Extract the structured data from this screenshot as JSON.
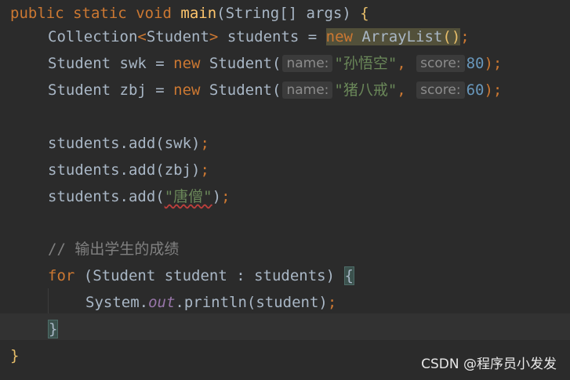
{
  "code": {
    "l1": {
      "kw1": "public",
      "kw2": "static",
      "kw3": "void",
      "fn": "main",
      "params": "(String[] args) ",
      "brace": "{"
    },
    "l2": {
      "type": "Collection",
      "lt": "<",
      "gen": "Student",
      "gt": ">",
      "rest": " students = ",
      "kw": "new",
      "cls": " ArrayList",
      "parens": "()",
      "semi": ";"
    },
    "l3": {
      "decl": "Student swk = ",
      "kw": "new",
      "ctor": " Student(",
      "hint1": "name:",
      "str": "\"孙悟空\"",
      "comma": ", ",
      "hint2": "score:",
      "num": "80",
      "end": ");"
    },
    "l4": {
      "decl": "Student zbj = ",
      "kw": "new",
      "ctor": " Student(",
      "hint1": "name:",
      "str": "\"猪八戒\"",
      "comma": ", ",
      "hint2": "score:",
      "num": "60",
      "end": ");"
    },
    "l6": {
      "pre": "students.add(swk)",
      "semi": ";"
    },
    "l7": {
      "pre": "students.add(zbj)",
      "semi": ";"
    },
    "l8": {
      "pre": "students.add(",
      "str": "\"唐僧\"",
      "post": ")",
      "semi": ";"
    },
    "l10": {
      "comment": "// 输出学生的成绩"
    },
    "l11": {
      "kw": "for",
      "rest": " (Student student : students) ",
      "brace": "{"
    },
    "l12": {
      "pre": "System.",
      "field": "out",
      "rest": ".println(student)",
      "semi": ";"
    },
    "l13": {
      "brace": "}"
    },
    "l14": {
      "brace": "}"
    }
  },
  "watermark": "CSDN @程序员小发发"
}
